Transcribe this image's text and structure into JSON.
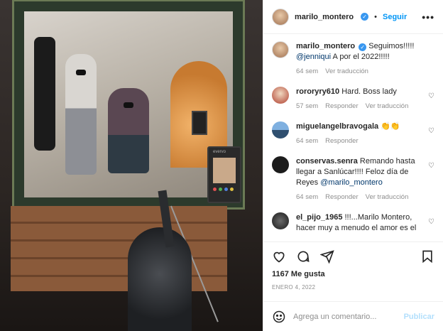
{
  "post": {
    "username": "marilo_montero",
    "follow_label": "Seguir",
    "separator": "•",
    "more_label": "•••",
    "likes": "1167 Me gusta",
    "date": "ENERO 4, 2022",
    "monitor_brand": "evervo"
  },
  "caption": {
    "username": "marilo_montero",
    "text_line1": "Seguimos!!!!!",
    "mention": "@jenniqui",
    "text_line2": "A por el 2022!!!!!",
    "time": "64 sem",
    "translate": "Ver traducción"
  },
  "comments": [
    {
      "username": "rororyry610",
      "text": "Hard. Boss lady",
      "time": "57 sem",
      "reply": "Responder",
      "translate": "Ver traducción",
      "avatar_color": "#d8c0a8"
    },
    {
      "username": "miguelangelbravogala",
      "text": "👏👏",
      "time": "64 sem",
      "reply": "Responder",
      "translate": "",
      "avatar_color": "#4f7ca8"
    },
    {
      "username": "conservas.senra",
      "text": "Remando hasta llegar a Sanlúcar!!!! Feloz día de Reyes",
      "mention": "@marilo_montero",
      "time": "64 sem",
      "reply": "Responder",
      "translate": "Ver traducción",
      "avatar_color": "#1c1c1c"
    },
    {
      "username": "el_pijo_1965",
      "text": "!!!...Marilo Montero, hacer muy a menudo el amor es el",
      "time": "",
      "reply": "",
      "translate": "",
      "avatar_color": "#3a3a3a"
    }
  ],
  "composer": {
    "placeholder": "Agrega un comentario...",
    "publish_label": "Publicar"
  },
  "colors": {
    "accent": "#0095f6",
    "verified": "#3897f0",
    "muted": "#8e8e8e"
  }
}
